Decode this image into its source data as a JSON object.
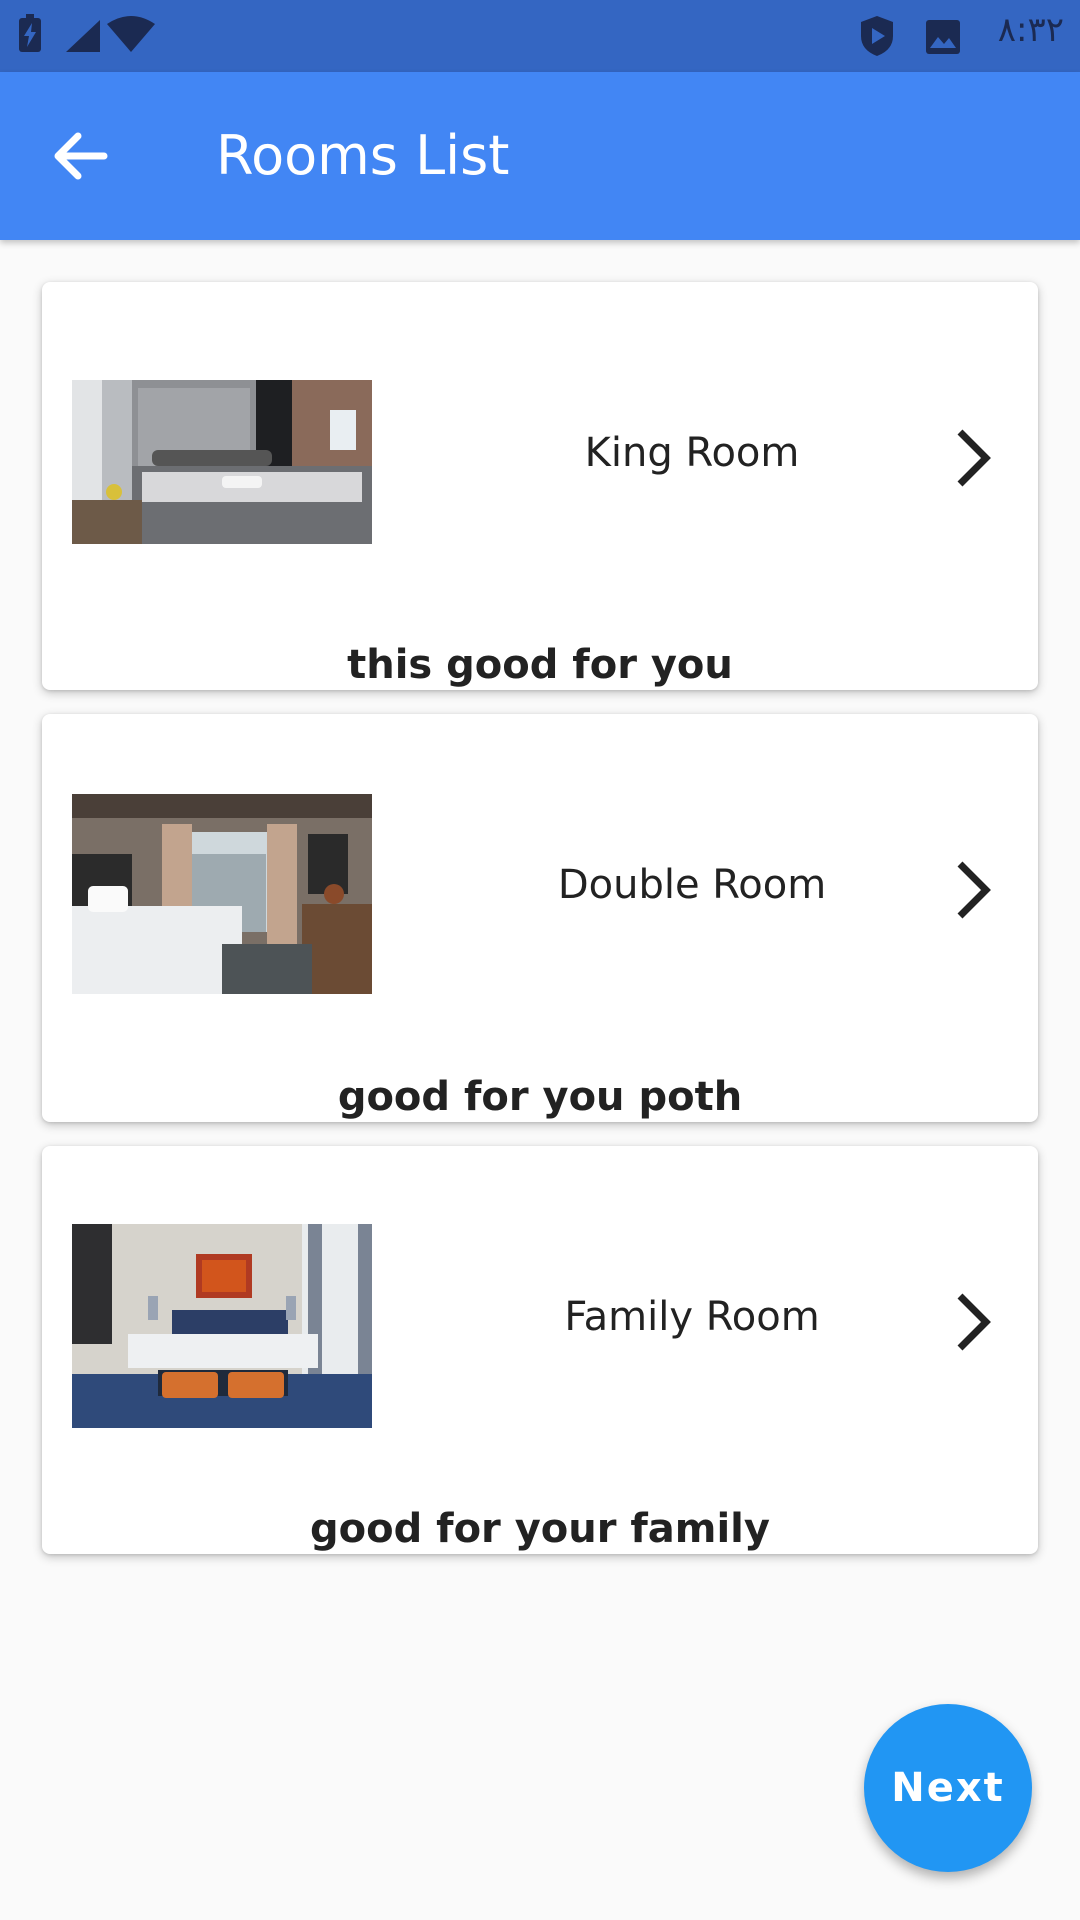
{
  "status_bar": {
    "time": "٨:٣٢",
    "left_icons": [
      "battery-charging-icon",
      "signal-icon",
      "wifi-icon"
    ],
    "right_icons": [
      "play-protect-icon",
      "image-icon"
    ]
  },
  "app_bar": {
    "back_icon": "arrow-back-icon",
    "title": "Rooms List",
    "color": "#4286f4"
  },
  "rooms": [
    {
      "name": "King Room",
      "description": "this good for you",
      "image": "bedroom-photo-king",
      "chevron": "chevron-right-icon"
    },
    {
      "name": "Double Room",
      "description": "good for you poth",
      "image": "bedroom-photo-double",
      "chevron": "chevron-right-icon"
    },
    {
      "name": "Family Room",
      "description": "good for your family",
      "image": "bedroom-photo-family",
      "chevron": "chevron-right-icon"
    }
  ],
  "fab": {
    "label": "Next",
    "color": "#2196f3"
  }
}
